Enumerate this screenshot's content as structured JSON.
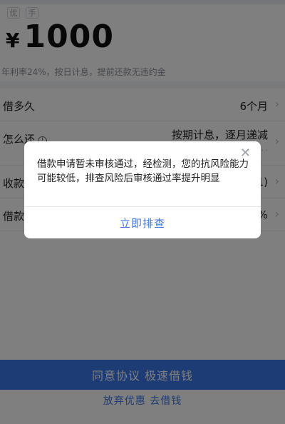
{
  "header": {
    "tags": [
      "优",
      "手"
    ]
  },
  "loan": {
    "currency": "¥",
    "amount": "1000",
    "rate_note": "年利率24%，按日计息，提前还款无违约金"
  },
  "rows": [
    {
      "label": "借多久",
      "value": "6个月"
    },
    {
      "label": "怎么还",
      "value": "按期计息，逐月递减",
      "sub": "· · ·"
    },
    {
      "label": "收款",
      "value": "1)"
    },
    {
      "label": "借款",
      "value": "%"
    }
  ],
  "dialog": {
    "message": "借款申请暂未审核通过，经检测，您的抗风险能力可能较低，排查风险后审核通过率提升明显",
    "action_label": "立即排查"
  },
  "footer": {
    "primary_button": "同意协议 极速借钱",
    "secondary_link": "放弃优惠 去借钱"
  },
  "colors": {
    "accent": "#3a76e8",
    "overlay": "rgba(0,0,0,0.5)"
  }
}
